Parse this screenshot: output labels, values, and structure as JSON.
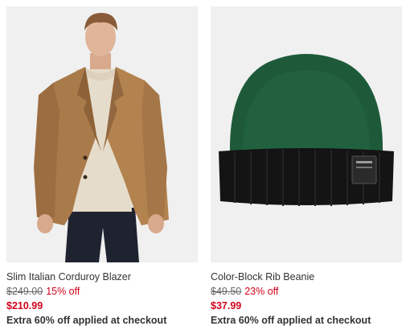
{
  "products": [
    {
      "name": "Slim Italian Corduroy Blazer",
      "original_price": "$249.00",
      "discount": "15% off",
      "sale_price": "$210.99",
      "promo": "Extra 60% off applied at checkout",
      "image": "product-photo-corduroy-blazer"
    },
    {
      "name": "Color-Block Rib Beanie",
      "original_price": "$49.50",
      "discount": "23% off",
      "sale_price": "$37.99",
      "promo": "Extra 60% off applied at checkout",
      "image": "product-photo-rib-beanie"
    }
  ],
  "colors": {
    "sale_red": "#d0021b",
    "text": "#333333",
    "strike_grey": "#666666",
    "image_bg": "#f0f0f0"
  }
}
